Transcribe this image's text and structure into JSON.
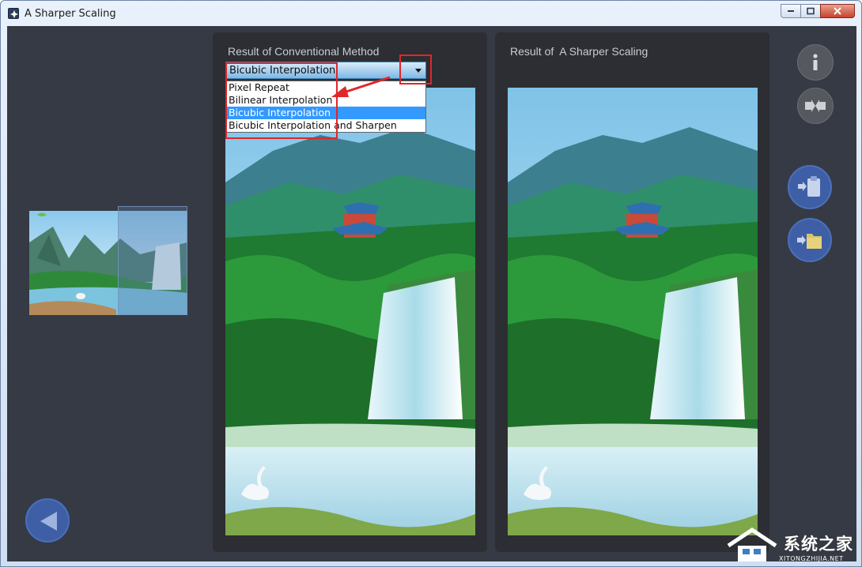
{
  "window": {
    "title": "A Sharper Scaling",
    "controls": [
      "minimize",
      "maximize",
      "close"
    ]
  },
  "left_panel": {
    "title": "Result of Conventional Method",
    "dropdown": {
      "selected": "Bicubic Interpolation",
      "options": [
        "Pixel Repeat",
        "Bilinear Interpolation",
        "Bicubic Interpolation",
        "Bicubic Interpolation and Sharpen"
      ],
      "selected_index": 2
    }
  },
  "right_panel": {
    "title": "Result of  A Sharper Scaling"
  },
  "sidebar": {
    "back_icon": "left-arrow-icon"
  },
  "toolbar": {
    "buttons": [
      "info-icon",
      "compare-icon",
      "paste-icon",
      "open-folder-icon"
    ]
  },
  "watermark": {
    "text": "系统之家",
    "url": "XITONGZHIJIA.NET"
  },
  "colors": {
    "client_bg": "#353a44",
    "panel_bg": "#2c2e33",
    "accent_blue": "#3e5fa6",
    "annotation_red": "#e0262a",
    "selection_blue": "#3399ff"
  }
}
